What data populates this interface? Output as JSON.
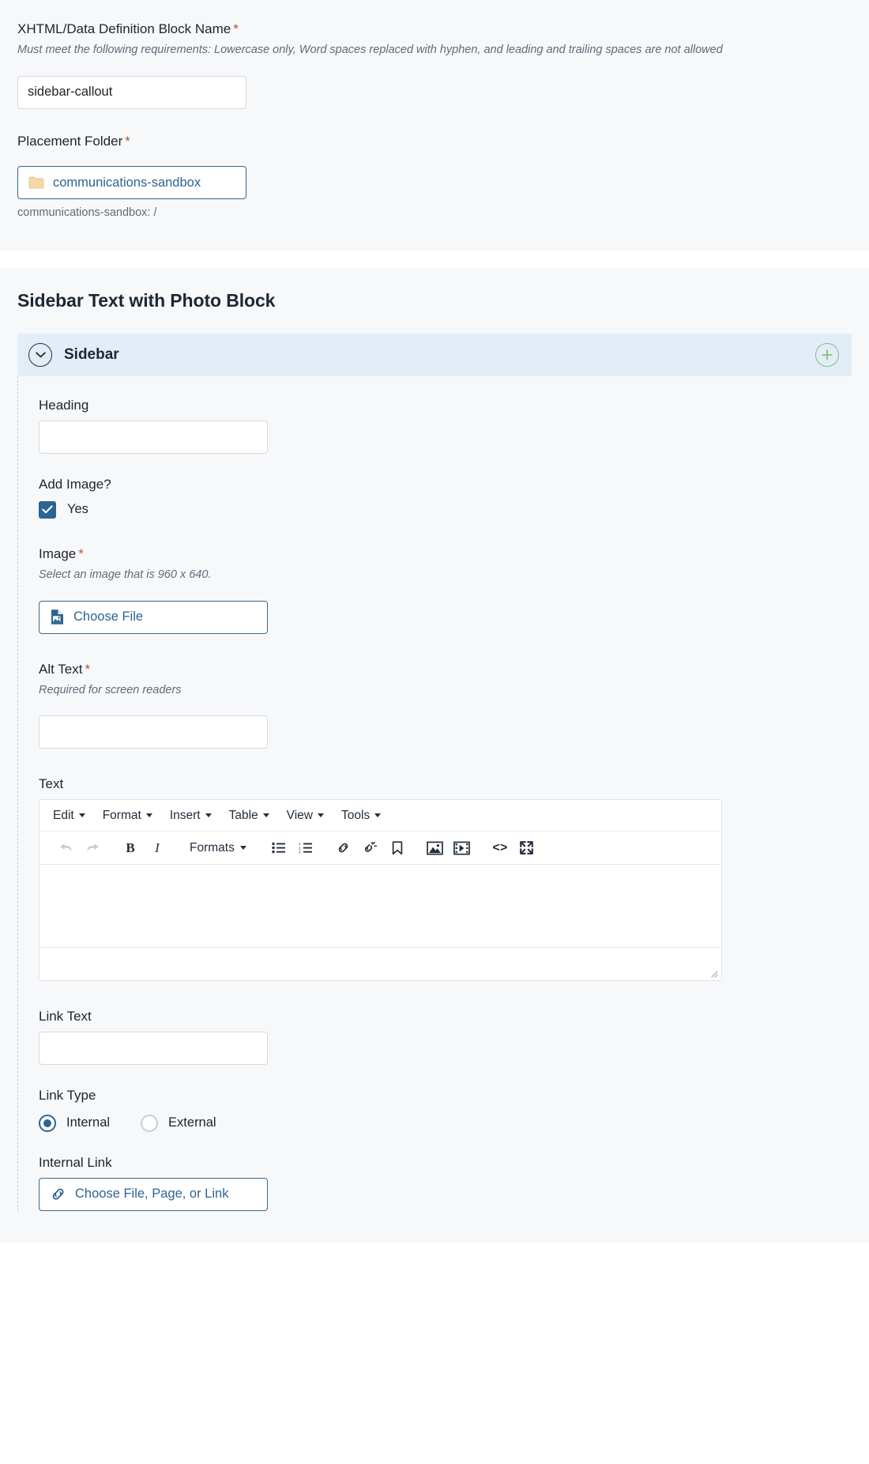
{
  "top_panel": {
    "block_name": {
      "label": "XHTML/Data Definition Block Name",
      "required_mark": "*",
      "help": "Must meet the following requirements: Lowercase only, Word spaces replaced with hyphen, and leading and trailing spaces are not allowed",
      "value": "sidebar-callout",
      "placeholder": ""
    },
    "placement_folder": {
      "label": "Placement Folder",
      "required_mark": "*",
      "chooser_label": "communications-sandbox",
      "path_note": "communications-sandbox: /"
    }
  },
  "main_panel": {
    "block_title": "Sidebar Text with Photo Block",
    "group": {
      "title": "Sidebar",
      "collapse_icon": "chevron-down-icon",
      "add_icon": "plus-circle-icon"
    },
    "fields": {
      "heading": {
        "label": "Heading",
        "value": "",
        "placeholder": ""
      },
      "add_image": {
        "label": "Add Image?",
        "checkbox_label": "Yes",
        "checked": true
      },
      "image": {
        "label": "Image",
        "required_mark": "*",
        "help": "Select an image that is 960 x 640.",
        "chooser_label": "Choose File",
        "chooser_icon": "image-file-icon"
      },
      "alt_text": {
        "label": "Alt Text",
        "required_mark": "*",
        "help": "Required for screen readers",
        "value": "",
        "placeholder": ""
      },
      "text": {
        "label": "Text"
      },
      "link_text": {
        "label": "Link Text",
        "value": "",
        "placeholder": ""
      },
      "link_type": {
        "label": "Link Type",
        "options": [
          {
            "label": "Internal",
            "selected": true
          },
          {
            "label": "External",
            "selected": false
          }
        ]
      },
      "internal_link": {
        "label": "Internal Link",
        "chooser_label": "Choose File, Page, or Link",
        "chooser_icon": "link-chain-icon"
      }
    },
    "editor": {
      "menus": [
        {
          "label": "Edit"
        },
        {
          "label": "Format"
        },
        {
          "label": "Insert"
        },
        {
          "label": "Table"
        },
        {
          "label": "View"
        },
        {
          "label": "Tools"
        }
      ],
      "toolbar": [
        {
          "name": "undo-icon",
          "label": "Undo",
          "disabled": true
        },
        {
          "name": "redo-icon",
          "label": "Redo",
          "disabled": true
        },
        {
          "name": "bold-icon",
          "label": "B",
          "disabled": false
        },
        {
          "name": "italic-icon",
          "label": "I",
          "disabled": false
        },
        {
          "name": "formats-dropdown",
          "label": "Formats",
          "disabled": false
        },
        {
          "name": "bullet-list-icon",
          "label": "Bullet list",
          "disabled": false
        },
        {
          "name": "numbered-list-icon",
          "label": "Numbered list",
          "disabled": false
        },
        {
          "name": "insert-link-icon",
          "label": "Insert link",
          "disabled": false
        },
        {
          "name": "unlink-icon",
          "label": "Remove link",
          "disabled": false
        },
        {
          "name": "anchor-icon",
          "label": "Anchor",
          "disabled": false
        },
        {
          "name": "insert-image-icon",
          "label": "Insert image",
          "disabled": false
        },
        {
          "name": "insert-media-icon",
          "label": "Insert media",
          "disabled": false
        },
        {
          "name": "source-code-icon",
          "label": "<>",
          "disabled": false
        },
        {
          "name": "fullscreen-icon",
          "label": "Fullscreen",
          "disabled": false
        }
      ],
      "content": ""
    }
  },
  "colors": {
    "panel_bg": "#f7f8fa",
    "group_header_bg": "#e3edf7",
    "accent_blue": "#2c6492",
    "required_red": "#b5542e",
    "add_green": "#7cc27f",
    "folder_yellow": "#f5d9a8",
    "dashed_rail": "#c3ccd4"
  }
}
